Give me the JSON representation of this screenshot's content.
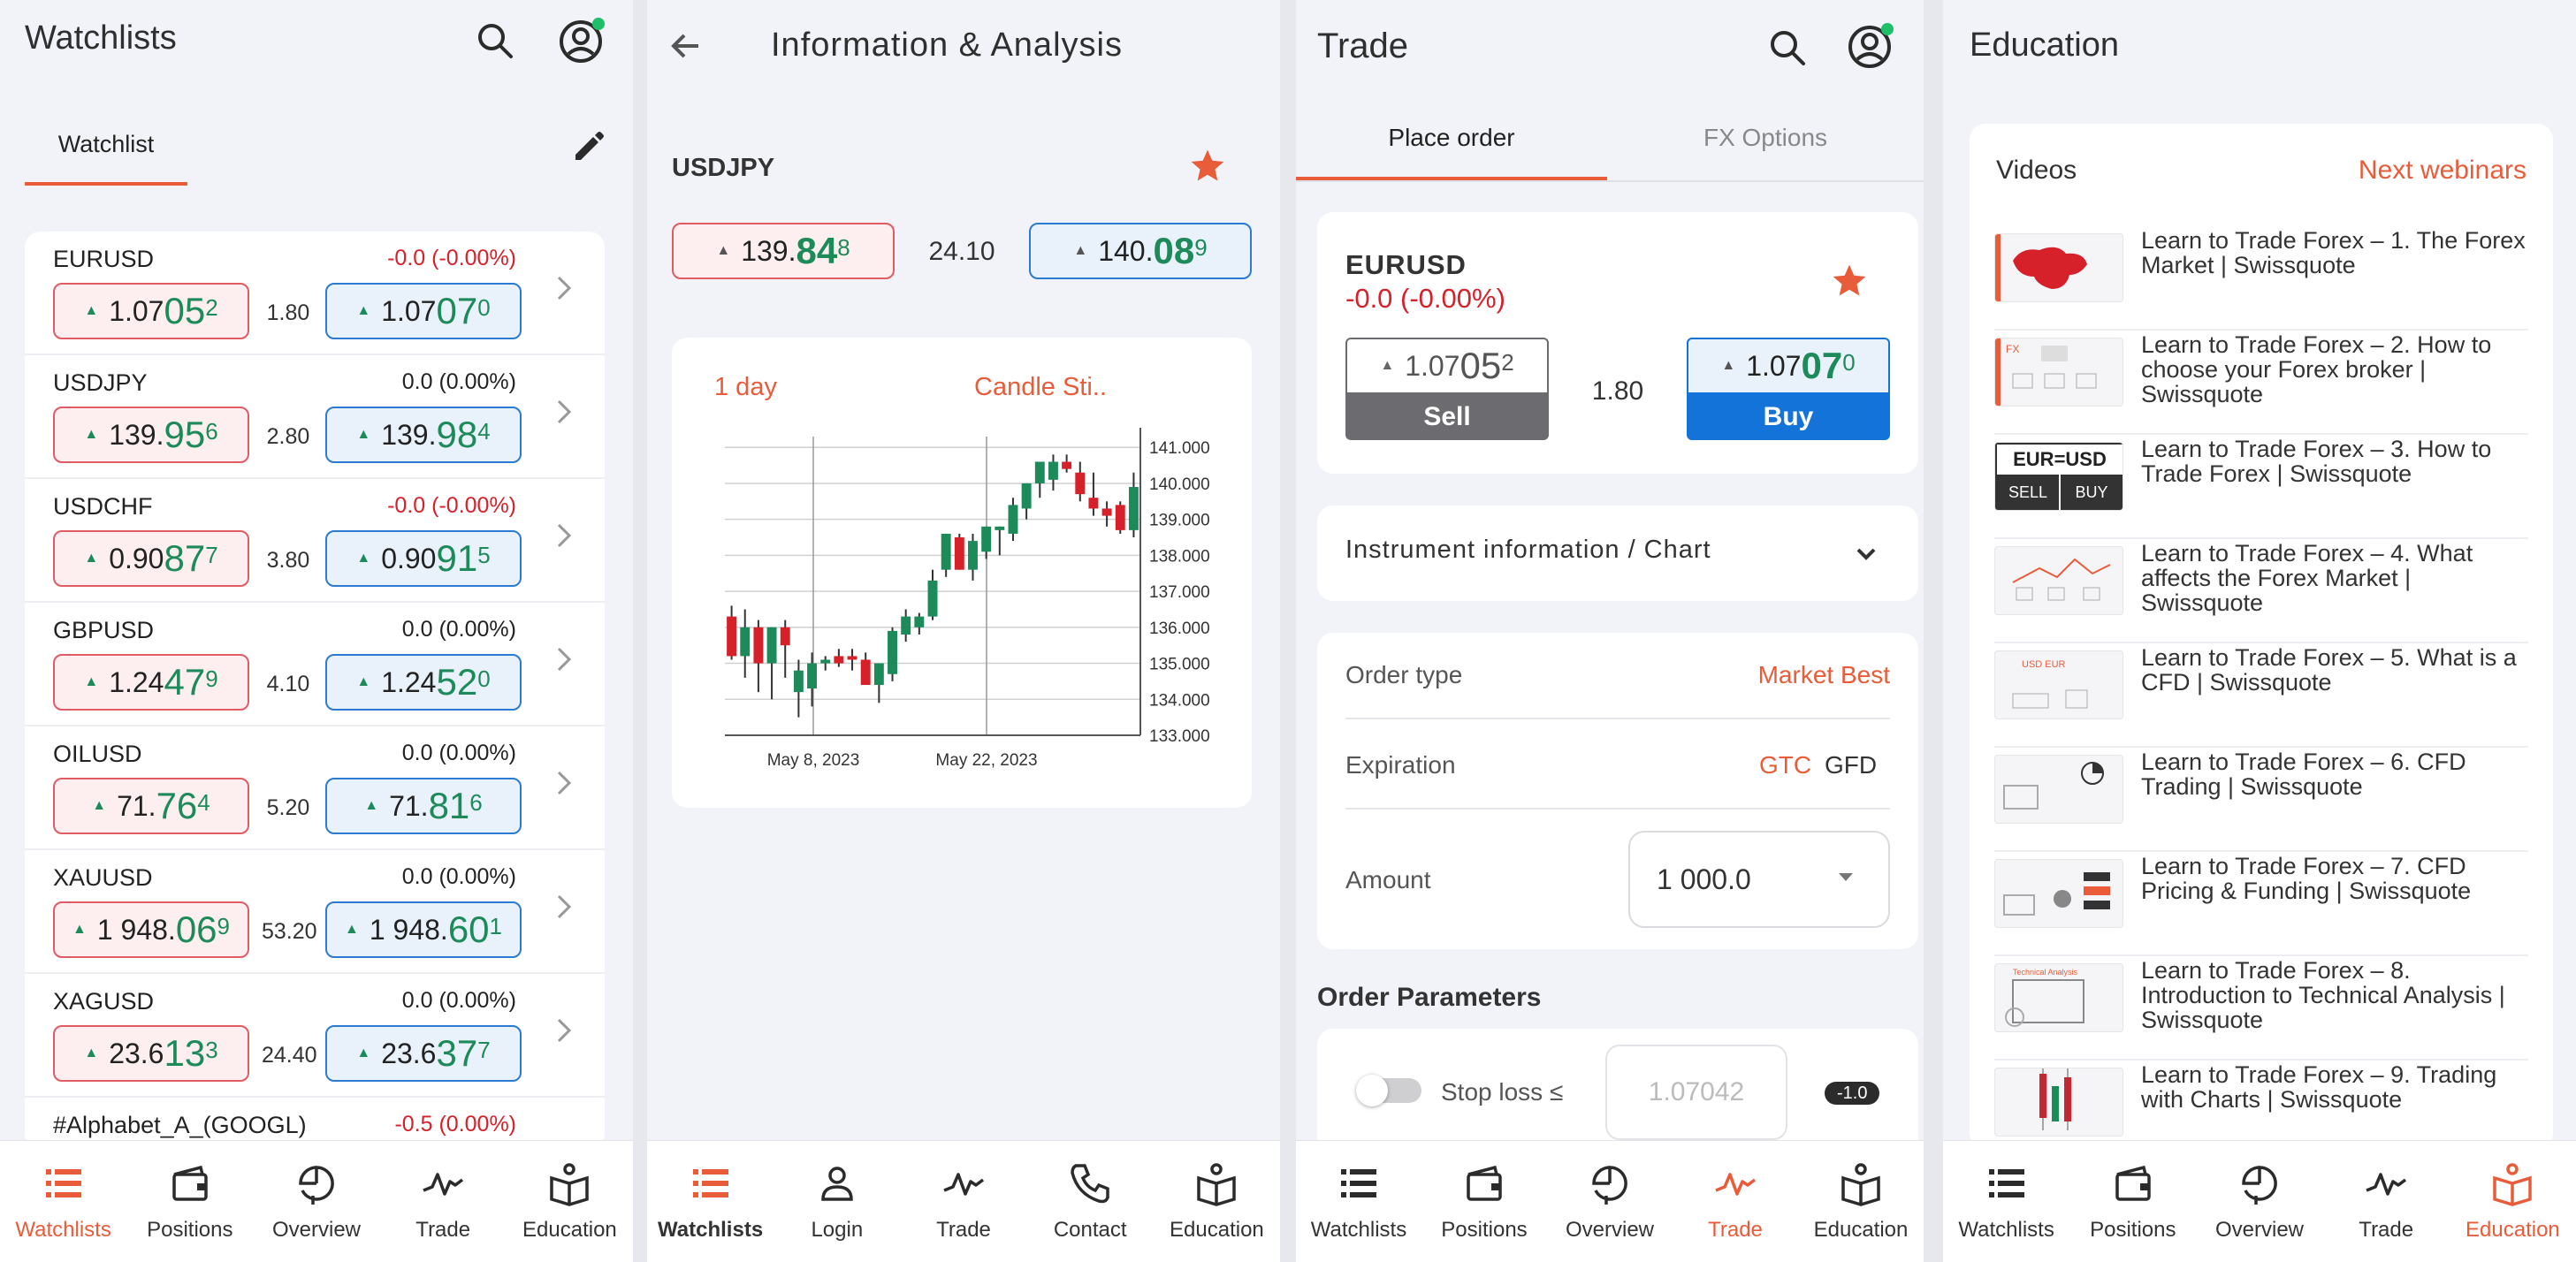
{
  "colors": {
    "accent": "#e85c3a",
    "negative": "#d6202a",
    "positive": "#1d8a5a",
    "buy_blue": "#1473d9",
    "sell_grey": "#6c6c70",
    "candle_up": "#1d8a5a",
    "candle_down": "#d6202a"
  },
  "s1": {
    "title": "Watchlists",
    "tab": "Watchlist",
    "rows": [
      {
        "symbol": "EURUSD",
        "change": "-0.0 (-0.00%)",
        "neg": true,
        "sell": {
          "pre": "1.07",
          "big": "05",
          "sup": "2"
        },
        "spread": "1.80",
        "buy": {
          "pre": "1.07",
          "big": "07",
          "sup": "0"
        }
      },
      {
        "symbol": "USDJPY",
        "change": "0.0 (0.00%)",
        "neg": false,
        "sell": {
          "pre": "139.",
          "big": "95",
          "sup": "6"
        },
        "spread": "2.80",
        "buy": {
          "pre": "139.",
          "big": "98",
          "sup": "4"
        }
      },
      {
        "symbol": "USDCHF",
        "change": "-0.0 (-0.00%)",
        "neg": true,
        "sell": {
          "pre": "0.90",
          "big": "87",
          "sup": "7"
        },
        "spread": "3.80",
        "buy": {
          "pre": "0.90",
          "big": "91",
          "sup": "5"
        }
      },
      {
        "symbol": "GBPUSD",
        "change": "0.0 (0.00%)",
        "neg": false,
        "sell": {
          "pre": "1.24",
          "big": "47",
          "sup": "9"
        },
        "spread": "4.10",
        "buy": {
          "pre": "1.24",
          "big": "52",
          "sup": "0"
        }
      },
      {
        "symbol": "OILUSD",
        "change": "0.0 (0.00%)",
        "neg": false,
        "sell": {
          "pre": "71.",
          "big": "76",
          "sup": "4"
        },
        "spread": "5.20",
        "buy": {
          "pre": "71.",
          "big": "81",
          "sup": "6"
        }
      },
      {
        "symbol": "XAUUSD",
        "change": "0.0 (0.00%)",
        "neg": false,
        "sell": {
          "pre": "1 948.",
          "big": "06",
          "sup": "9"
        },
        "spread": "53.20",
        "buy": {
          "pre": "1 948.",
          "big": "60",
          "sup": "1"
        }
      },
      {
        "symbol": "XAGUSD",
        "change": "0.0 (0.00%)",
        "neg": false,
        "sell": {
          "pre": "23.6",
          "big": "13",
          "sup": "3"
        },
        "spread": "24.40",
        "buy": {
          "pre": "23.6",
          "big": "37",
          "sup": "7"
        }
      }
    ],
    "partial_row": {
      "symbol": "#Alphabet_A_(GOOGL)",
      "change": "-0.5 (0.00%)"
    },
    "nav": [
      "Watchlists",
      "Positions",
      "Overview",
      "Trade",
      "Education"
    ]
  },
  "s2": {
    "title": "Information & Analysis",
    "symbol": "USDJPY",
    "sell": {
      "pre": "139.",
      "big": "84",
      "sup": "8"
    },
    "spread": "24.10",
    "buy": {
      "pre": "140.",
      "big": "08",
      "sup": "9"
    },
    "period": "1 day",
    "chart_kind": "Candle Sti..",
    "nav": [
      "Watchlists",
      "Login",
      "Trade",
      "Contact",
      "Education"
    ]
  },
  "chart_data": {
    "type": "candlestick",
    "x_tick_labels": [
      "May 8, 2023",
      "May 22, 2023"
    ],
    "y_ticks": [
      "141.000",
      "140.000",
      "139.000",
      "138.000",
      "137.000",
      "136.000",
      "135.000",
      "134.000",
      "133.000"
    ],
    "ylim": [
      133,
      141.3
    ],
    "candles": [
      {
        "o": 136.3,
        "h": 136.6,
        "l": 135.1,
        "c": 135.2
      },
      {
        "o": 135.2,
        "h": 136.5,
        "l": 134.6,
        "c": 136.0
      },
      {
        "o": 136.0,
        "h": 136.2,
        "l": 134.2,
        "c": 135.0
      },
      {
        "o": 135.0,
        "h": 136.0,
        "l": 134.0,
        "c": 136.0
      },
      {
        "o": 136.0,
        "h": 136.2,
        "l": 134.6,
        "c": 135.5
      },
      {
        "o": 134.2,
        "h": 135.1,
        "l": 133.5,
        "c": 134.8
      },
      {
        "o": 134.3,
        "h": 135.3,
        "l": 133.8,
        "c": 135.0
      },
      {
        "o": 135.0,
        "h": 135.2,
        "l": 134.8,
        "c": 135.1
      },
      {
        "o": 135.2,
        "h": 135.4,
        "l": 134.9,
        "c": 135.0
      },
      {
        "o": 135.2,
        "h": 135.4,
        "l": 134.8,
        "c": 135.1
      },
      {
        "o": 135.1,
        "h": 135.3,
        "l": 134.4,
        "c": 134.4
      },
      {
        "o": 134.4,
        "h": 135.0,
        "l": 133.9,
        "c": 135.0
      },
      {
        "o": 134.7,
        "h": 136.0,
        "l": 134.5,
        "c": 135.9
      },
      {
        "o": 135.8,
        "h": 136.5,
        "l": 135.6,
        "c": 136.3
      },
      {
        "o": 136.0,
        "h": 136.4,
        "l": 135.8,
        "c": 136.3
      },
      {
        "o": 136.3,
        "h": 137.6,
        "l": 136.2,
        "c": 137.3
      },
      {
        "o": 137.6,
        "h": 138.6,
        "l": 137.4,
        "c": 138.6
      },
      {
        "o": 138.5,
        "h": 138.6,
        "l": 137.6,
        "c": 137.6
      },
      {
        "o": 137.6,
        "h": 138.6,
        "l": 137.3,
        "c": 138.4
      },
      {
        "o": 138.1,
        "h": 138.8,
        "l": 137.9,
        "c": 138.8
      },
      {
        "o": 138.7,
        "h": 138.8,
        "l": 138.0,
        "c": 138.8
      },
      {
        "o": 138.6,
        "h": 139.6,
        "l": 138.4,
        "c": 139.4
      },
      {
        "o": 139.3,
        "h": 140.0,
        "l": 139.0,
        "c": 140.0
      },
      {
        "o": 140.0,
        "h": 140.6,
        "l": 139.6,
        "c": 140.6
      },
      {
        "o": 140.1,
        "h": 140.8,
        "l": 139.8,
        "c": 140.6
      },
      {
        "o": 140.6,
        "h": 140.8,
        "l": 140.3,
        "c": 140.4
      },
      {
        "o": 140.3,
        "h": 140.6,
        "l": 139.5,
        "c": 139.7
      },
      {
        "o": 139.6,
        "h": 140.3,
        "l": 139.1,
        "c": 139.3
      },
      {
        "o": 139.3,
        "h": 139.5,
        "l": 138.8,
        "c": 139.1
      },
      {
        "o": 139.4,
        "h": 139.5,
        "l": 138.6,
        "c": 138.7
      },
      {
        "o": 138.7,
        "h": 140.3,
        "l": 138.5,
        "c": 139.9
      }
    ]
  },
  "s3": {
    "title": "Trade",
    "tabs": [
      "Place order",
      "FX Options"
    ],
    "symbol": "EURUSD",
    "change": "-0.0 (-0.00%)",
    "sell": {
      "pre": "1.07",
      "big": "05",
      "sup": "2"
    },
    "spread": "1.80",
    "buy": {
      "pre": "1.07",
      "big": "07",
      "sup": "0"
    },
    "sell_label": "Sell",
    "buy_label": "Buy",
    "instrument_info": "Instrument information / Chart",
    "order_type_label": "Order type",
    "order_type_value": "Market Best",
    "expiration_label": "Expiration",
    "exp_gtc": "GTC",
    "exp_gfd": "GFD",
    "amount_label": "Amount",
    "amount_value": "1 000.0",
    "order_params": "Order Parameters",
    "stop_loss_label": "Stop loss ≤",
    "stop_loss_placeholder": "1.07042",
    "stop_loss_badge": "-1.0",
    "nav": [
      "Watchlists",
      "Positions",
      "Overview",
      "Trade",
      "Education"
    ]
  },
  "s4": {
    "title": "Education",
    "videos_tab": "Videos",
    "next_webinars": "Next webinars",
    "videos": [
      "Learn to Trade Forex – 1. The Forex Market | Swissquote",
      "Learn to Trade Forex – 2. How to choose your Forex broker | Swissquote",
      "Learn to Trade Forex – 3. How to Trade Forex | Swissquote",
      "Learn to Trade Forex – 4. What affects the Forex Market | Swissquote",
      "Learn to Trade Forex – 5. What is a CFD | Swissquote",
      "Learn to Trade Forex – 6. CFD Trading | Swissquote",
      "Learn to Trade Forex – 7. CFD Pricing & Funding | Swissquote",
      "Learn to Trade Forex – 8. Introduction to Technical Analysis | Swissquote",
      "Learn to Trade Forex – 9. Trading with Charts | Swissquote"
    ],
    "thumb3": {
      "pair": "EUR=USD",
      "sell": "SELL",
      "buy": "BUY"
    },
    "thumb2_text": "FX",
    "thumb4_text": "USD EUR",
    "thumb8_text": "Technical Analysis",
    "nav": [
      "Watchlists",
      "Positions",
      "Overview",
      "Trade",
      "Education"
    ]
  }
}
